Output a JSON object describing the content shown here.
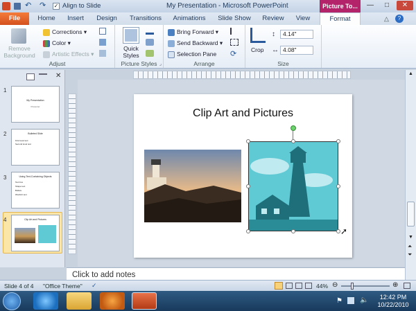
{
  "window": {
    "title": "My Presentation - Microsoft PowerPoint",
    "qat_align_label": "Align to Slide",
    "context_tab": "Picture To..."
  },
  "tabs": [
    {
      "label": "File"
    },
    {
      "label": "Home"
    },
    {
      "label": "Insert"
    },
    {
      "label": "Design"
    },
    {
      "label": "Transitions"
    },
    {
      "label": "Animations"
    },
    {
      "label": "Slide Show"
    },
    {
      "label": "Review"
    },
    {
      "label": "View"
    },
    {
      "label": "Format"
    }
  ],
  "ribbon": {
    "adjust": {
      "label": "Adjust",
      "remove_bg": "Remove\nBackground",
      "corrections": "Corrections",
      "color": "Color",
      "artistic": "Artistic Effects"
    },
    "styles": {
      "label": "Picture Styles",
      "quick": "Quick\nStyles"
    },
    "arrange": {
      "label": "Arrange",
      "bring": "Bring Forward",
      "send": "Send Backward",
      "selection": "Selection Pane"
    },
    "size": {
      "label": "Size",
      "crop": "Crop",
      "height": "4.14\"",
      "width": "4.08\""
    }
  },
  "slides": [
    {
      "num": "1",
      "title": "My Presentation",
      "sub": "Presenter"
    },
    {
      "num": "2",
      "title": "Bulleted Slide",
      "lines": [
        "First level text",
        "Second level text"
      ]
    },
    {
      "num": "3",
      "title": "Using Text-Containing Objects",
      "lines": [
        "Text box",
        "Shape text",
        "Bullets",
        "WordArt text"
      ]
    },
    {
      "num": "4",
      "title": "Clip Art and Pictures"
    }
  ],
  "slide": {
    "title": "Clip Art and Pictures"
  },
  "notes": {
    "placeholder": "Click to add notes"
  },
  "status": {
    "slide": "Slide 4 of 4",
    "theme": "\"Office Theme\"",
    "zoom": "44%"
  },
  "clock": {
    "time": "12:42 PM",
    "date": "10/22/2010"
  },
  "colors": {
    "file_tab": "#d3501e",
    "context_tab": "#b4246b",
    "clipart": "#5fc9d4"
  }
}
